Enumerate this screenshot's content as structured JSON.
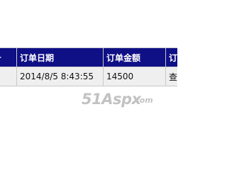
{
  "orders_table": {
    "headers": [
      "号",
      "订单日期",
      "订单金额",
      "订"
    ],
    "rows": [
      [
        "",
        "2014/8/5 8:43:55",
        "14500",
        "查"
      ]
    ]
  },
  "watermark": {
    "main": "51Aspx",
    "sub": ".com"
  },
  "colors": {
    "header_bg": "#0f0f86",
    "header_text": "#ffffff",
    "row_bg": "#efefef",
    "border": "#c8c8c8",
    "watermark": "#c2c2c2"
  }
}
